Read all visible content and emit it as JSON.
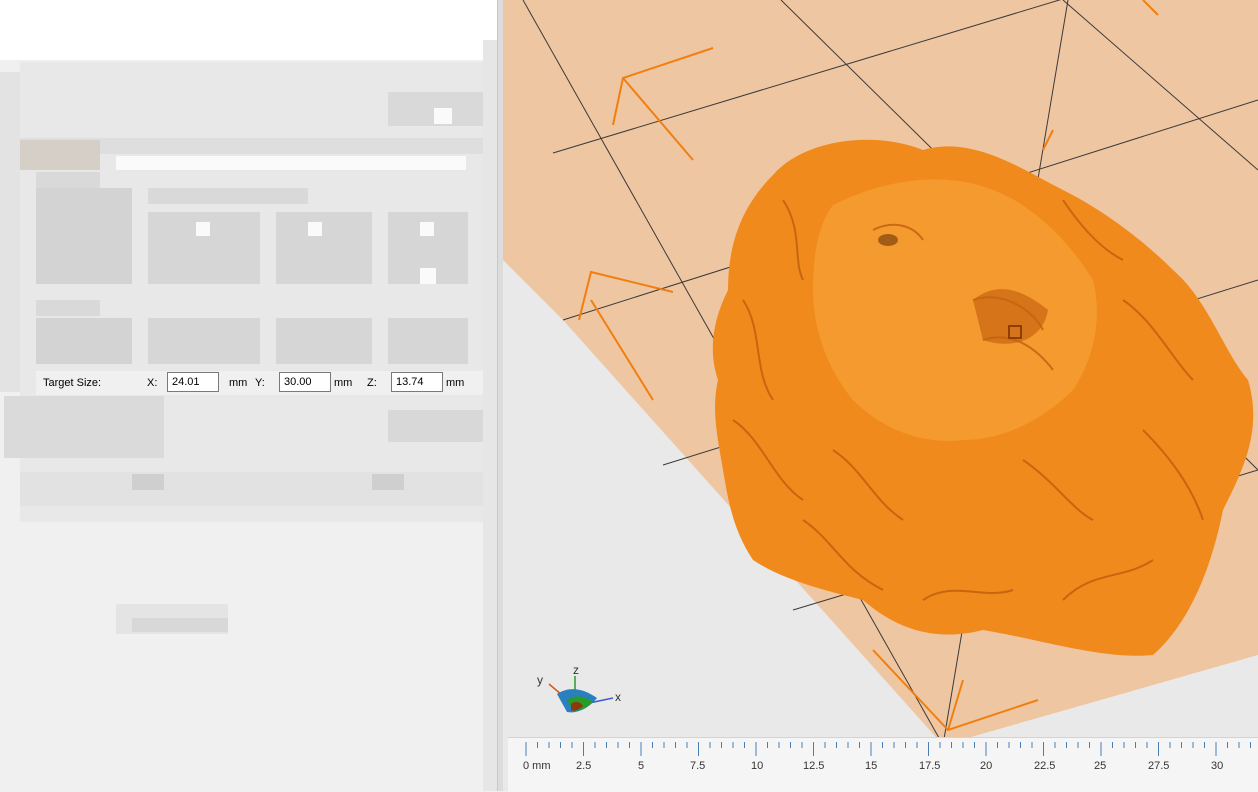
{
  "target_size": {
    "label": "Target Size:",
    "x_label": "X:",
    "x_value": "24.01",
    "y_label": "Y:",
    "y_value": "30.00",
    "z_label": "Z:",
    "z_value": "13.74",
    "unit": "mm"
  },
  "axis_gizmo": {
    "x": "x",
    "y": "y",
    "z": "z"
  },
  "ruler": {
    "labels": [
      "0 mm",
      "2.5",
      "5",
      "7.5",
      "10",
      "12.5",
      "15",
      "17.5",
      "20",
      "22.5",
      "25",
      "27.5",
      "30"
    ]
  },
  "colors": {
    "model": "#f08a1c",
    "bed": "#efc6a2",
    "bounding_box": "#f07f10"
  }
}
